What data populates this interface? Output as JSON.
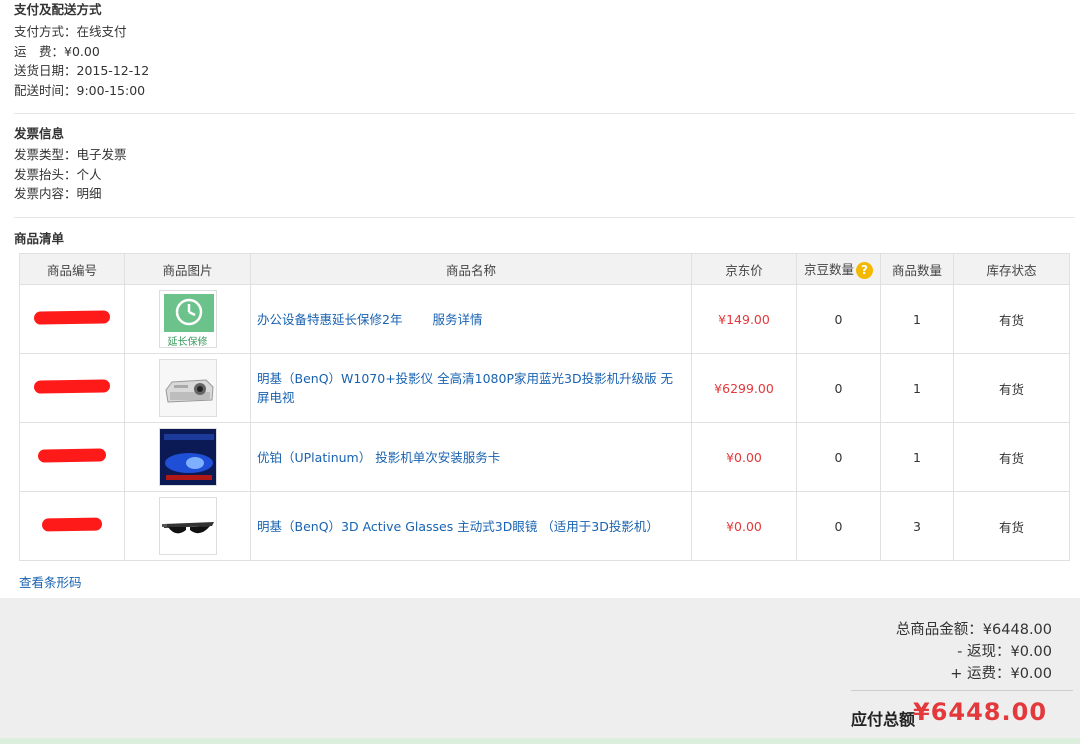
{
  "payment": {
    "title": "支付及配送方式",
    "method": "支付方式：在线支付",
    "shipping_fee": "运　费：¥0.00",
    "delivery_date": "送货日期：2015-12-12",
    "delivery_time": "配送时间：9:00-15:00"
  },
  "invoice": {
    "title": "发票信息",
    "type": "发票类型：电子发票",
    "header": "发票抬头：个人",
    "content": "发票内容：明细"
  },
  "goods": {
    "title": "商品清单",
    "columns": [
      "商品编号",
      "商品图片",
      "商品名称",
      "京东价",
      "京豆数量",
      "商品数量",
      "库存状态"
    ],
    "help_icon": "question-icon",
    "rows": [
      {
        "name": "办公设备特惠延长保修2年",
        "service_link": "服务详情",
        "price": "¥149.00",
        "beans": "0",
        "qty": "1",
        "stock": "有货",
        "thumb_label": "延长保修"
      },
      {
        "name": "明基（BenQ）W1070+投影仪 全高清1080P家用蓝光3D投影机升级版 无屏电视",
        "service_link": "",
        "price": "¥6299.00",
        "beans": "0",
        "qty": "1",
        "stock": "有货",
        "thumb_label": ""
      },
      {
        "name": "优铂（UPlatinum） 投影机单次安装服务卡",
        "service_link": "",
        "price": "¥0.00",
        "beans": "0",
        "qty": "1",
        "stock": "有货",
        "thumb_label": ""
      },
      {
        "name": "明基（BenQ）3D Active Glasses 主动式3D眼镜 （适用于3D投影机）",
        "service_link": "",
        "price": "¥0.00",
        "beans": "0",
        "qty": "3",
        "stock": "有货",
        "thumb_label": ""
      }
    ],
    "barcode_link": "查看条形码"
  },
  "summary": {
    "total_goods": "总商品金额：¥6448.00",
    "cashback": "- 返现：¥0.00",
    "freight": "+ 运费：¥0.00",
    "payable_label": "应付总额",
    "payable_value": "¥6448.00"
  },
  "colors": {
    "price": "#e4393c",
    "link": "#1862b0",
    "redaction": "#ff1a1a",
    "bean_help": "#f5b800"
  }
}
